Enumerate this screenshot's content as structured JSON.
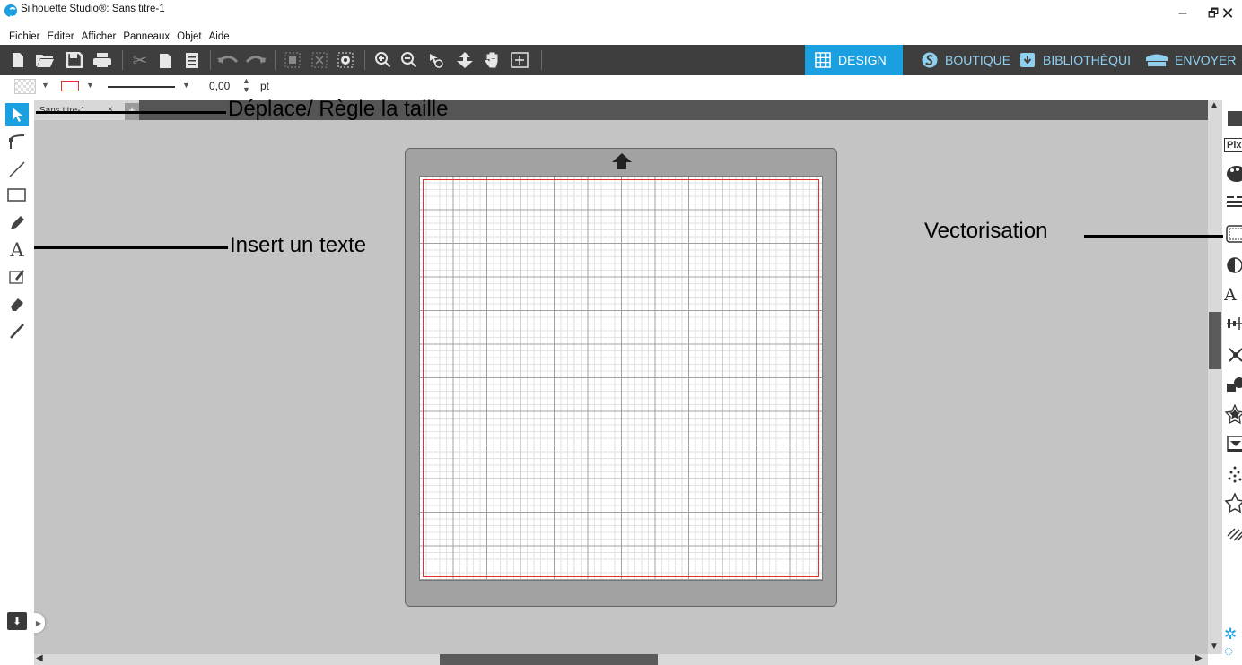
{
  "window": {
    "title": "Silhouette Studio®: Sans titre-1",
    "controls": {
      "minimize": "–",
      "maximize": "🗗",
      "close": "✕"
    }
  },
  "menu": [
    "Fichier",
    "Editer",
    "Afficher",
    "Panneaux",
    "Objet",
    "Aide"
  ],
  "toolbar": {
    "icons": [
      "new-document-icon",
      "open-folder-icon",
      "save-icon",
      "print-icon",
      "cut-icon",
      "copy-icon",
      "paste-icon",
      "undo-icon",
      "redo-icon",
      "group-icon",
      "ungroup-icon",
      "compound-path-icon",
      "zoom-in-icon",
      "zoom-out-icon",
      "zoom-select-icon",
      "drag-zoom-icon",
      "pan-hand-icon",
      "fit-to-page-icon"
    ],
    "tabs": [
      {
        "label": "DESIGN",
        "icon": "grid-icon",
        "active": true
      },
      {
        "label": "BOUTIQUE",
        "icon": "silhouette-logo-icon",
        "active": false
      },
      {
        "label": "BIBLIOTHÈQUI",
        "icon": "library-download-icon",
        "active": false
      },
      {
        "label": "ENVOYER",
        "icon": "cutter-machine-icon",
        "active": false
      }
    ],
    "accent_color": "#1aa0e0"
  },
  "properties": {
    "line_width": "0,00",
    "unit": "pt",
    "line_color": "#e03030"
  },
  "document": {
    "tab_label": "Sans titre-1",
    "close_glyph": "×",
    "add_tab": "+"
  },
  "left_tools": [
    "select-arrow-icon",
    "point-edit-icon",
    "line-icon",
    "rectangle-icon",
    "pencil-icon",
    "text-icon",
    "eraser-icon",
    "knife-icon"
  ],
  "right_tools": [
    "page-setup-icon",
    "pixscan-icon",
    "fill-icon",
    "line-style-icon",
    "trace-icon",
    "contrast-icon",
    "text-style-icon",
    "align-icon",
    "replicate-icon",
    "modify-icon",
    "star-offset-icon",
    "image-effects-icon",
    "dots-icon",
    "sketch-icon",
    "hatch-icon",
    "settings-gear-icon"
  ],
  "right_tool_labels": {
    "pixscan": "Pix",
    "text_style": "A"
  },
  "annotations": {
    "move_resize": "Déplace/  Règle la taille",
    "insert_text": "Insert un texte",
    "vectorisation": "Vectorisation"
  }
}
